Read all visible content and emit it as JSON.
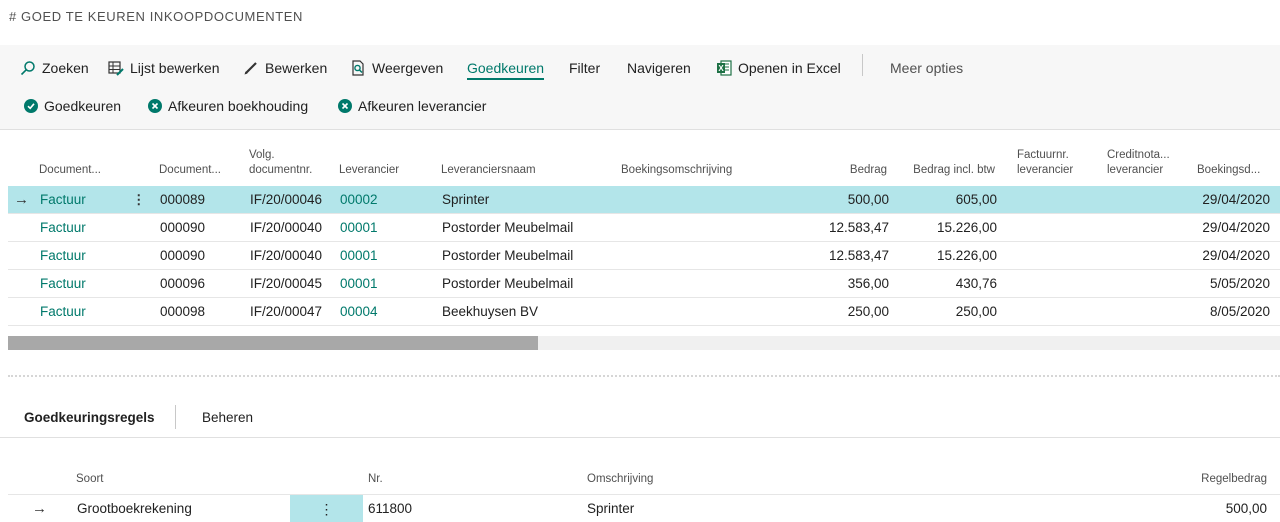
{
  "page": {
    "title": "# GOED TE KEUREN INKOOPDOCUMENTEN"
  },
  "actions": {
    "search": "Zoeken",
    "edit_list": "Lijst bewerken",
    "edit": "Bewerken",
    "view": "Weergeven",
    "approve_tab": "Goedkeuren",
    "filter": "Filter",
    "navigate": "Navigeren",
    "excel": "Openen in Excel",
    "more": "Meer opties"
  },
  "sub_actions": {
    "approve": "Goedkeuren",
    "reject_accounting": "Afkeuren boekhouding",
    "reject_vendor": "Afkeuren leverancier"
  },
  "columns": {
    "doc_type": "Document...",
    "doc_no": "Document...",
    "next_doc_line1": "Volg.",
    "next_doc_line2": "documentnr.",
    "vendor": "Leverancier",
    "vendor_name": "Leveranciersnaam",
    "posting_desc": "Boekingsomschrijving",
    "amount": "Bedrag",
    "amount_vat": "Bedrag incl. btw",
    "invoice_no_line1": "Factuurnr.",
    "invoice_no_line2": "leverancier",
    "credit_line1": "Creditnota...",
    "credit_line2": "leverancier",
    "posting_date": "Boekingsd..."
  },
  "rows": [
    {
      "doc_type": "Factuur",
      "doc_no": "000089",
      "next_doc": "IF/20/00046",
      "vendor": "00002",
      "vendor_name": "Sprinter",
      "amount": "500,00",
      "amount_vat": "605,00",
      "date": "29/04/2020"
    },
    {
      "doc_type": "Factuur",
      "doc_no": "000090",
      "next_doc": "IF/20/00040",
      "vendor": "00001",
      "vendor_name": "Postorder Meubelmail",
      "amount": "12.583,47",
      "amount_vat": "15.226,00",
      "date": "29/04/2020"
    },
    {
      "doc_type": "Factuur",
      "doc_no": "000090",
      "next_doc": "IF/20/00040",
      "vendor": "00001",
      "vendor_name": "Postorder Meubelmail",
      "amount": "12.583,47",
      "amount_vat": "15.226,00",
      "date": "29/04/2020"
    },
    {
      "doc_type": "Factuur",
      "doc_no": "000096",
      "next_doc": "IF/20/00045",
      "vendor": "00001",
      "vendor_name": "Postorder Meubelmail",
      "amount": "356,00",
      "amount_vat": "430,76",
      "date": "5/05/2020"
    },
    {
      "doc_type": "Factuur",
      "doc_no": "000098",
      "next_doc": "IF/20/00047",
      "vendor": "00004",
      "vendor_name": "Beekhuysen BV",
      "amount": "250,00",
      "amount_vat": "250,00",
      "date": "8/05/2020"
    }
  ],
  "subpage": {
    "tab_lines": "Goedkeuringsregels",
    "tab_manage": "Beheren",
    "columns": {
      "type": "Soort",
      "no": "Nr.",
      "description": "Omschrijving",
      "line_amount": "Regelbedrag"
    },
    "lines": [
      {
        "type": "Grootboekrekening",
        "no": "611800",
        "description": "Sprinter",
        "line_amount": "500,00"
      }
    ]
  },
  "colors": {
    "accent": "#00796b",
    "selected_row": "#b3e5ea"
  }
}
